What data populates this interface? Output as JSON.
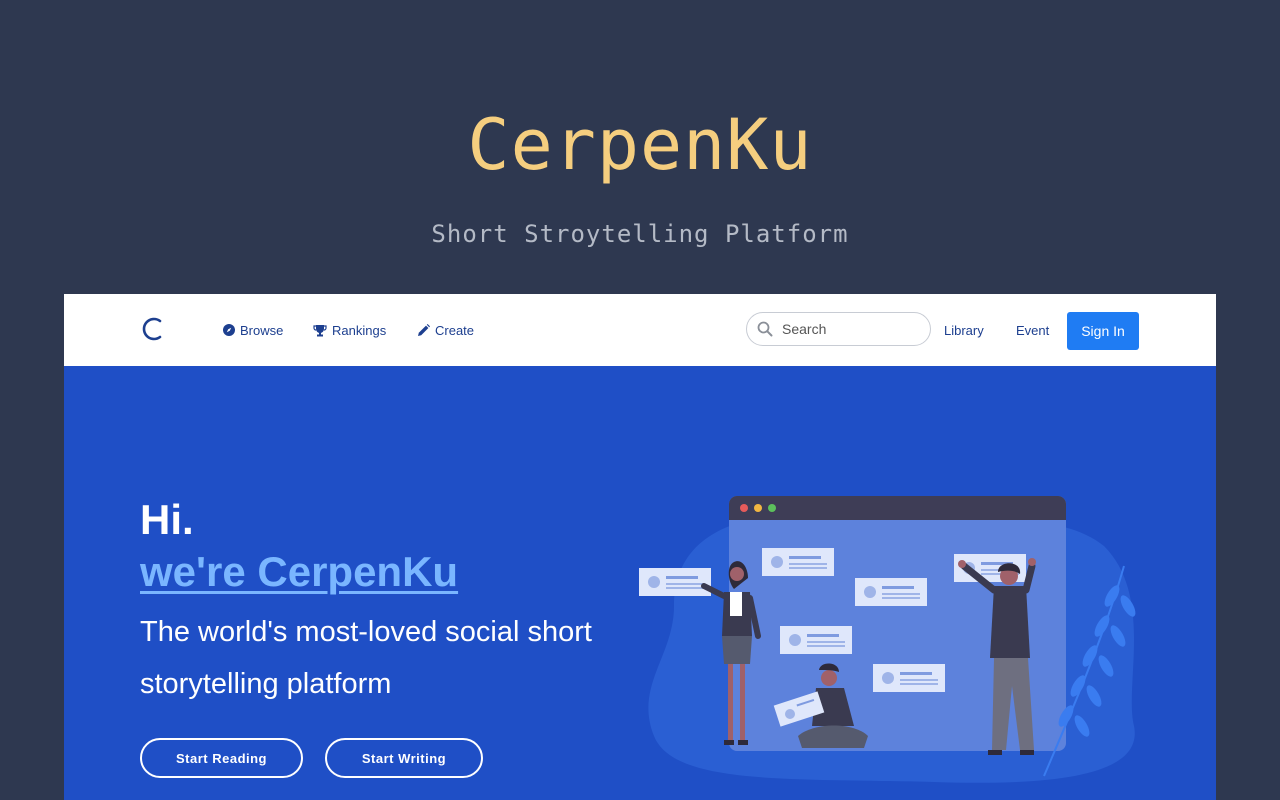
{
  "showcase": {
    "title": "CerpenKu",
    "subtitle": "Short Stroytelling Platform"
  },
  "navbar": {
    "logo_icon": "c-logo-icon",
    "links": [
      {
        "label": "Browse",
        "icon": "compass-icon"
      },
      {
        "label": "Rankings",
        "icon": "trophy-icon"
      },
      {
        "label": "Create",
        "icon": "pencil-icon"
      }
    ],
    "search": {
      "placeholder": "Search",
      "icon": "search-icon"
    },
    "library_label": "Library",
    "event_label": "Event",
    "signin_label": "Sign In"
  },
  "hero": {
    "greeting": "Hi.",
    "brand": "we're CerpenKu",
    "tagline": "The world's most-loved social short storytelling platform",
    "start_reading_label": "Start Reading",
    "start_writing_label": "Start Writing"
  },
  "colors": {
    "page_bg": "#2e3850",
    "title": "#f5ce7f",
    "hero_bg": "#1f4fc6",
    "brand_link": "#7ab6ff",
    "signin_button": "#1f7cf3",
    "nav_text": "#1d3f8f"
  }
}
